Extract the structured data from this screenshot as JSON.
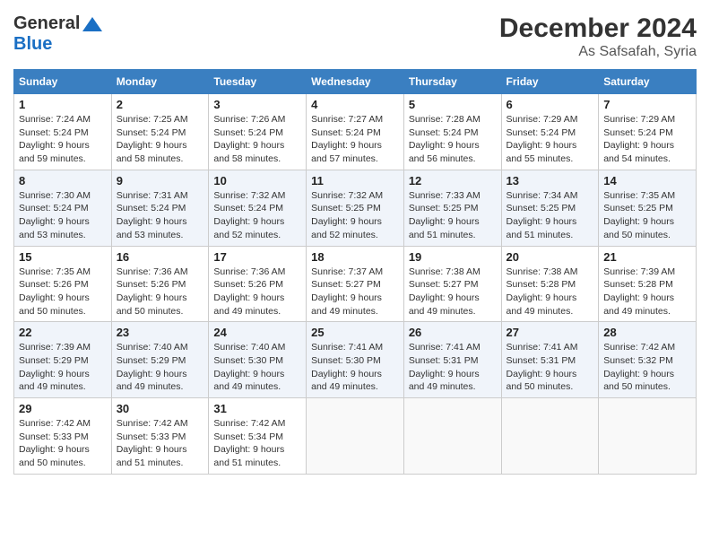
{
  "header": {
    "logo_general": "General",
    "logo_blue": "Blue",
    "month": "December 2024",
    "location": "As Safsafah, Syria"
  },
  "weekdays": [
    "Sunday",
    "Monday",
    "Tuesday",
    "Wednesday",
    "Thursday",
    "Friday",
    "Saturday"
  ],
  "weeks": [
    [
      {
        "day": "1",
        "sunrise": "Sunrise: 7:24 AM",
        "sunset": "Sunset: 5:24 PM",
        "daylight": "Daylight: 9 hours and 59 minutes."
      },
      {
        "day": "2",
        "sunrise": "Sunrise: 7:25 AM",
        "sunset": "Sunset: 5:24 PM",
        "daylight": "Daylight: 9 hours and 58 minutes."
      },
      {
        "day": "3",
        "sunrise": "Sunrise: 7:26 AM",
        "sunset": "Sunset: 5:24 PM",
        "daylight": "Daylight: 9 hours and 58 minutes."
      },
      {
        "day": "4",
        "sunrise": "Sunrise: 7:27 AM",
        "sunset": "Sunset: 5:24 PM",
        "daylight": "Daylight: 9 hours and 57 minutes."
      },
      {
        "day": "5",
        "sunrise": "Sunrise: 7:28 AM",
        "sunset": "Sunset: 5:24 PM",
        "daylight": "Daylight: 9 hours and 56 minutes."
      },
      {
        "day": "6",
        "sunrise": "Sunrise: 7:29 AM",
        "sunset": "Sunset: 5:24 PM",
        "daylight": "Daylight: 9 hours and 55 minutes."
      },
      {
        "day": "7",
        "sunrise": "Sunrise: 7:29 AM",
        "sunset": "Sunset: 5:24 PM",
        "daylight": "Daylight: 9 hours and 54 minutes."
      }
    ],
    [
      {
        "day": "8",
        "sunrise": "Sunrise: 7:30 AM",
        "sunset": "Sunset: 5:24 PM",
        "daylight": "Daylight: 9 hours and 53 minutes."
      },
      {
        "day": "9",
        "sunrise": "Sunrise: 7:31 AM",
        "sunset": "Sunset: 5:24 PM",
        "daylight": "Daylight: 9 hours and 53 minutes."
      },
      {
        "day": "10",
        "sunrise": "Sunrise: 7:32 AM",
        "sunset": "Sunset: 5:24 PM",
        "daylight": "Daylight: 9 hours and 52 minutes."
      },
      {
        "day": "11",
        "sunrise": "Sunrise: 7:32 AM",
        "sunset": "Sunset: 5:25 PM",
        "daylight": "Daylight: 9 hours and 52 minutes."
      },
      {
        "day": "12",
        "sunrise": "Sunrise: 7:33 AM",
        "sunset": "Sunset: 5:25 PM",
        "daylight": "Daylight: 9 hours and 51 minutes."
      },
      {
        "day": "13",
        "sunrise": "Sunrise: 7:34 AM",
        "sunset": "Sunset: 5:25 PM",
        "daylight": "Daylight: 9 hours and 51 minutes."
      },
      {
        "day": "14",
        "sunrise": "Sunrise: 7:35 AM",
        "sunset": "Sunset: 5:25 PM",
        "daylight": "Daylight: 9 hours and 50 minutes."
      }
    ],
    [
      {
        "day": "15",
        "sunrise": "Sunrise: 7:35 AM",
        "sunset": "Sunset: 5:26 PM",
        "daylight": "Daylight: 9 hours and 50 minutes."
      },
      {
        "day": "16",
        "sunrise": "Sunrise: 7:36 AM",
        "sunset": "Sunset: 5:26 PM",
        "daylight": "Daylight: 9 hours and 50 minutes."
      },
      {
        "day": "17",
        "sunrise": "Sunrise: 7:36 AM",
        "sunset": "Sunset: 5:26 PM",
        "daylight": "Daylight: 9 hours and 49 minutes."
      },
      {
        "day": "18",
        "sunrise": "Sunrise: 7:37 AM",
        "sunset": "Sunset: 5:27 PM",
        "daylight": "Daylight: 9 hours and 49 minutes."
      },
      {
        "day": "19",
        "sunrise": "Sunrise: 7:38 AM",
        "sunset": "Sunset: 5:27 PM",
        "daylight": "Daylight: 9 hours and 49 minutes."
      },
      {
        "day": "20",
        "sunrise": "Sunrise: 7:38 AM",
        "sunset": "Sunset: 5:28 PM",
        "daylight": "Daylight: 9 hours and 49 minutes."
      },
      {
        "day": "21",
        "sunrise": "Sunrise: 7:39 AM",
        "sunset": "Sunset: 5:28 PM",
        "daylight": "Daylight: 9 hours and 49 minutes."
      }
    ],
    [
      {
        "day": "22",
        "sunrise": "Sunrise: 7:39 AM",
        "sunset": "Sunset: 5:29 PM",
        "daylight": "Daylight: 9 hours and 49 minutes."
      },
      {
        "day": "23",
        "sunrise": "Sunrise: 7:40 AM",
        "sunset": "Sunset: 5:29 PM",
        "daylight": "Daylight: 9 hours and 49 minutes."
      },
      {
        "day": "24",
        "sunrise": "Sunrise: 7:40 AM",
        "sunset": "Sunset: 5:30 PM",
        "daylight": "Daylight: 9 hours and 49 minutes."
      },
      {
        "day": "25",
        "sunrise": "Sunrise: 7:41 AM",
        "sunset": "Sunset: 5:30 PM",
        "daylight": "Daylight: 9 hours and 49 minutes."
      },
      {
        "day": "26",
        "sunrise": "Sunrise: 7:41 AM",
        "sunset": "Sunset: 5:31 PM",
        "daylight": "Daylight: 9 hours and 49 minutes."
      },
      {
        "day": "27",
        "sunrise": "Sunrise: 7:41 AM",
        "sunset": "Sunset: 5:31 PM",
        "daylight": "Daylight: 9 hours and 50 minutes."
      },
      {
        "day": "28",
        "sunrise": "Sunrise: 7:42 AM",
        "sunset": "Sunset: 5:32 PM",
        "daylight": "Daylight: 9 hours and 50 minutes."
      }
    ],
    [
      {
        "day": "29",
        "sunrise": "Sunrise: 7:42 AM",
        "sunset": "Sunset: 5:33 PM",
        "daylight": "Daylight: 9 hours and 50 minutes."
      },
      {
        "day": "30",
        "sunrise": "Sunrise: 7:42 AM",
        "sunset": "Sunset: 5:33 PM",
        "daylight": "Daylight: 9 hours and 51 minutes."
      },
      {
        "day": "31",
        "sunrise": "Sunrise: 7:42 AM",
        "sunset": "Sunset: 5:34 PM",
        "daylight": "Daylight: 9 hours and 51 minutes."
      },
      null,
      null,
      null,
      null
    ]
  ]
}
